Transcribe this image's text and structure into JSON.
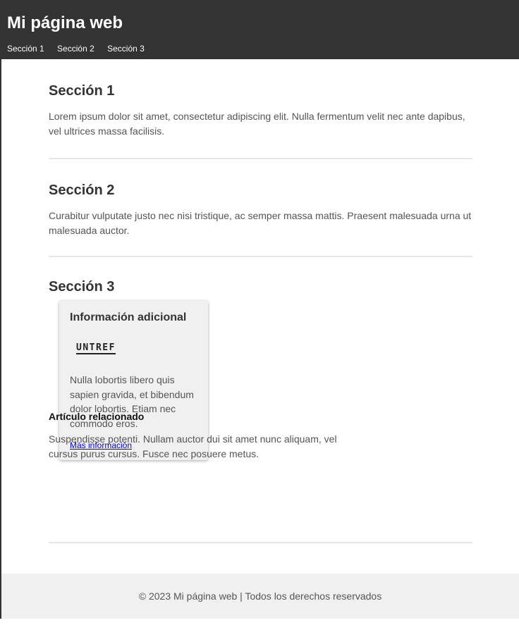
{
  "header": {
    "title": "Mi página web",
    "nav": [
      "Sección 1",
      "Sección 2",
      "Sección 3"
    ]
  },
  "sections": [
    {
      "title": "Sección 1",
      "text": "Lorem ipsum dolor sit amet, consectetur adipiscing elit. Nulla fermentum velit nec ante dapibus, vel ultrices massa facilisis."
    },
    {
      "title": "Sección 2",
      "text": "Curabitur vulputate justo nec nisi tristique, ac semper massa mattis. Praesent malesuada urna ut malesuada auctor."
    },
    {
      "title": "Sección 3"
    }
  ],
  "card": {
    "title": "Información adicional",
    "logo_text": "UNTREF",
    "text": "Nulla lobortis libero quis sapien gravida, et bibendum dolor lobortis. Etiam nec commodo eros.",
    "link": "Más información"
  },
  "related": {
    "title": "Artículo relacionado",
    "text": "Suspendisse potenti. Nullam auctor dui sit amet nunc aliquam, vel cursus purus cursus. Fusce nec posuere metus."
  },
  "footer": {
    "text": "© 2023 Mi página web | Todos los derechos reservados"
  },
  "colors": {
    "header_bg": "#333333",
    "footer_bg": "#f0f0f0",
    "card_bg": "#f0f0f0",
    "link": "#0000ee"
  }
}
